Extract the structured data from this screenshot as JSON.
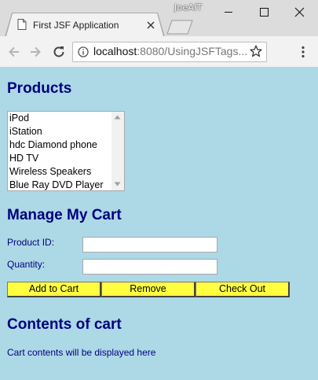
{
  "window": {
    "user_label": "JoeAIT",
    "tab_title": "First JSF Application"
  },
  "address_bar": {
    "host": "localhost",
    "path": ":8080/UsingJSFTags..."
  },
  "icons": {
    "page": "page-icon",
    "close": "close-icon",
    "back": "back-arrow-icon",
    "forward": "forward-arrow-icon",
    "reload": "reload-icon",
    "info": "info-icon",
    "star": "star-icon",
    "menu": "kebab-menu-icon"
  },
  "colors": {
    "page_background": "#add8e6",
    "heading": "#00007f",
    "button": "#ffff40"
  },
  "products": {
    "heading": "Products",
    "items": [
      "iPod",
      "iStation",
      "hdc Diamond phone",
      "HD TV",
      "Wireless Speakers",
      "Blue Ray DVD Player"
    ]
  },
  "cart_form": {
    "heading": "Manage My Cart",
    "product_id_label": "Product ID:",
    "product_id_value": "",
    "quantity_label": "Quantity:",
    "quantity_value": "",
    "buttons": {
      "add": "Add to Cart",
      "remove": "Remove",
      "checkout": "Check Out"
    }
  },
  "contents": {
    "heading": "Contents of cart",
    "text": "Cart contents will be displayed here"
  }
}
